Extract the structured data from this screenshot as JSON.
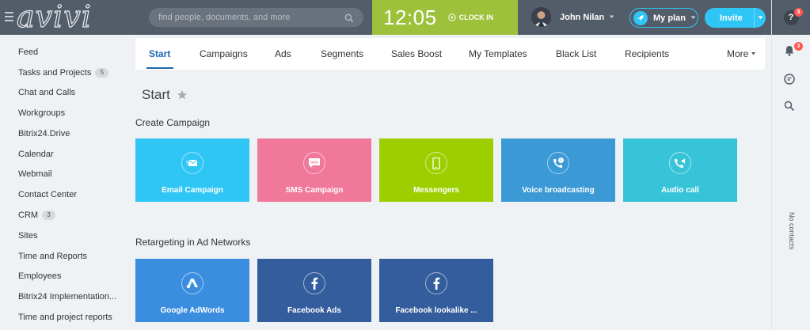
{
  "header": {
    "logo": "avivi",
    "search_placeholder": "find people, documents, and more",
    "clock_time": "12:05",
    "clock_in_label": "CLOCK IN",
    "user_name": "John Nilan",
    "plan_label": "My plan",
    "invite_label": "Invite"
  },
  "right_panel": {
    "help_badge": "3",
    "notifications_badge": "3",
    "no_contacts": "No contacts"
  },
  "sidebar": {
    "items": [
      {
        "label": "Feed",
        "counter": ""
      },
      {
        "label": "Tasks and Projects",
        "counter": "5"
      },
      {
        "label": "Chat and Calls",
        "counter": ""
      },
      {
        "label": "Workgroups",
        "counter": ""
      },
      {
        "label": "Bitrix24.Drive",
        "counter": ""
      },
      {
        "label": "Calendar",
        "counter": ""
      },
      {
        "label": "Webmail",
        "counter": ""
      },
      {
        "label": "Contact Center",
        "counter": ""
      },
      {
        "label": "CRM",
        "counter": "3"
      },
      {
        "label": "Sites",
        "counter": ""
      },
      {
        "label": "Time and Reports",
        "counter": ""
      },
      {
        "label": "Employees",
        "counter": ""
      },
      {
        "label": "Bitrix24 Implementation...",
        "counter": ""
      },
      {
        "label": "Time and project reports",
        "counter": ""
      }
    ]
  },
  "tabs": [
    {
      "label": "Start",
      "active": true
    },
    {
      "label": "Campaigns"
    },
    {
      "label": "Ads"
    },
    {
      "label": "Segments"
    },
    {
      "label": "Sales Boost"
    },
    {
      "label": "My Templates"
    },
    {
      "label": "Black List"
    },
    {
      "label": "Recipients"
    },
    {
      "label": "More"
    }
  ],
  "page_title": "Start",
  "sections": {
    "create_campaign": {
      "title": "Create Campaign",
      "tiles": [
        {
          "label": "Email Campaign",
          "icon": "email-icon",
          "color": "#2fc6f6"
        },
        {
          "label": "SMS Campaign",
          "icon": "sms-icon",
          "color": "#f0789b"
        },
        {
          "label": "Messengers",
          "icon": "smartphone-icon",
          "color": "#9dcf00"
        },
        {
          "label": "Voice broadcasting",
          "icon": "voice-broadcast-icon",
          "color": "#3b9ad6"
        },
        {
          "label": "Audio call",
          "icon": "audio-call-icon",
          "color": "#38c4d8"
        }
      ]
    },
    "retargeting": {
      "title": "Retargeting in Ad Networks",
      "tiles": [
        {
          "label": "Google AdWords",
          "icon": "google-adwords-icon",
          "color": "#3b8de0"
        },
        {
          "label": "Facebook Ads",
          "icon": "facebook-icon",
          "color": "#335d9c"
        },
        {
          "label": "Facebook lookalike ...",
          "icon": "facebook-icon",
          "color": "#335d9c"
        }
      ]
    }
  }
}
